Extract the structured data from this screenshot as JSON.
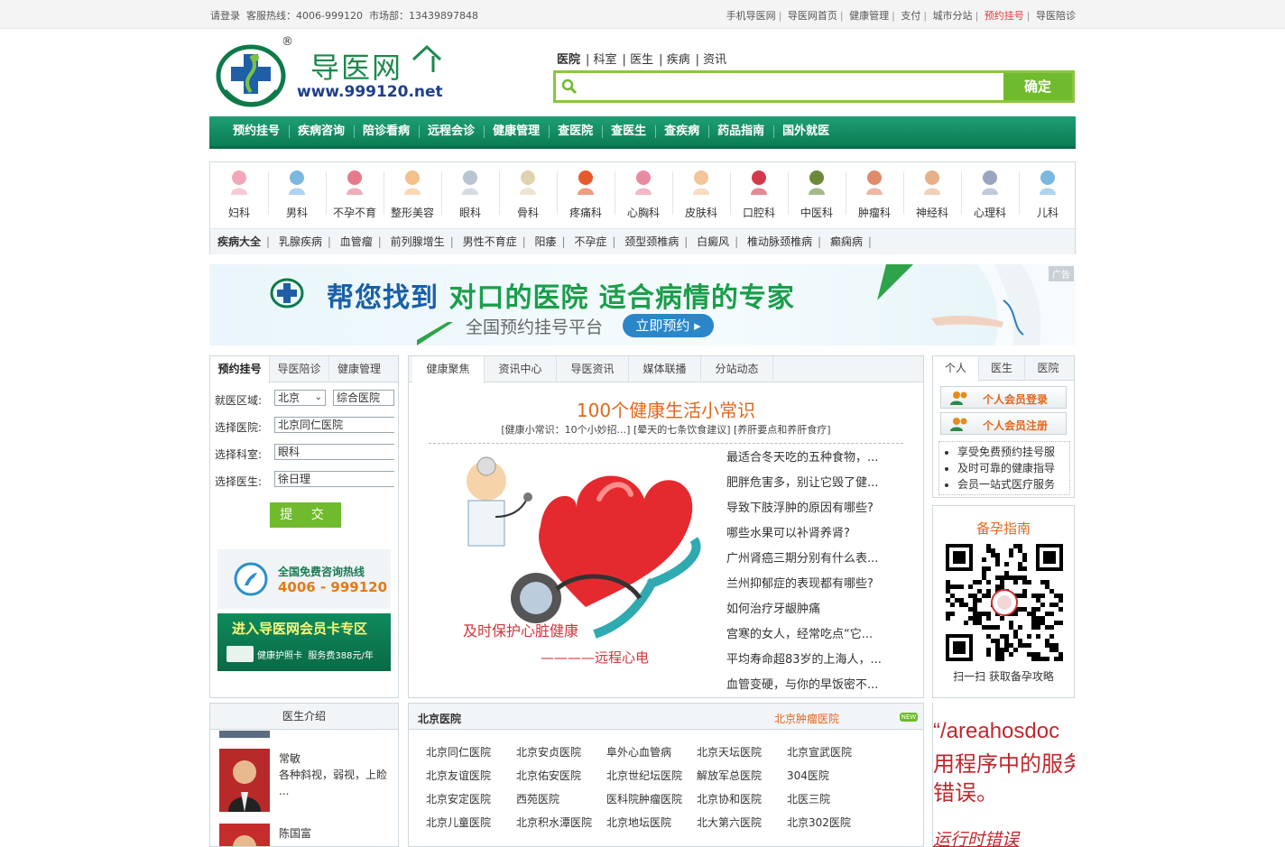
{
  "topbar": {
    "login": "请登录",
    "hotline": "客服热线：4006-999120",
    "market": "市场部：13439897848",
    "links": [
      "手机导医网",
      "导医网首页",
      "健康管理",
      "支付",
      "城市分站",
      "预约挂号",
      "导医陪诊"
    ]
  },
  "logo": {
    "name": "导医网",
    "url": "www.999120.net",
    "mark": "®"
  },
  "search": {
    "tabs": [
      "医院",
      "科室",
      "医生",
      "疾病",
      "资讯"
    ],
    "placeholder": "",
    "button": "确定"
  },
  "nav": [
    "预约挂号",
    "疾病咨询",
    "陪诊看病",
    "远程会诊",
    "健康管理",
    "查医院",
    "查医生",
    "查疾病",
    "药品指南",
    "国外就医"
  ],
  "departments": [
    "妇科",
    "男科",
    "不孕不育",
    "整形美容",
    "眼科",
    "骨科",
    "疼痛科",
    "心胸科",
    "皮肤科",
    "口腔科",
    "中医科",
    "肿瘤科",
    "神经科",
    "心理科",
    "儿科"
  ],
  "diseases": {
    "label": "疾病大全",
    "items": [
      "乳腺疾病",
      "血管瘤",
      "前列腺增生",
      "男性不育症",
      "阳痿",
      "不孕症",
      "颈型颈椎病",
      "白癜风",
      "椎动脉颈椎病",
      "癫痫病"
    ]
  },
  "banner": {
    "ad_tag": "广告",
    "headline_a": "帮您找到",
    "headline_b": "对口的医院 适合病情的专家",
    "sub": "全国预约挂号平台",
    "button": "立即预约 ▸"
  },
  "booking": {
    "tabs": [
      "预约挂号",
      "导医陪诊",
      "健康管理"
    ],
    "area_label": "就医区域:",
    "area_value": "北京",
    "area_type": "综合医院",
    "hospital_label": "选择医院:",
    "hospital_value": "北京同仁医院",
    "dept_label": "选择科室:",
    "dept_value": "眼科",
    "doctor_label": "选择医生:",
    "doctor_value": "徐日理",
    "submit": "提 交"
  },
  "hotline_box": {
    "title": "全国免费咨询热线",
    "number": "4006 - 999120"
  },
  "member_zone": {
    "title": "进入导医网会员卡专区",
    "card": "健康护照卡",
    "fee": "服务费388元/年"
  },
  "center": {
    "tabs": [
      "健康聚焦",
      "资讯中心",
      "导医资讯",
      "媒体联播",
      "分站动态"
    ],
    "title": "100个健康生活小常识",
    "subtitle": "[健康小常识：10个小妙招...] [晕天的七条饮食建议] [养肝要点和养肝食疗]",
    "image_caption1": "及时保护心脏健康",
    "image_caption2": "————远程心电",
    "news": [
      "最适合冬天吃的五种食物，...",
      "肥胖危害多，别让它毁了健...",
      "导致下肢浮肿的原因有哪些?",
      "哪些水果可以补肾养肾?",
      "广州肾癌三期分别有什么表...",
      "兰州抑郁症的表现都有哪些?",
      "如何治疗牙龈肿痛",
      "宫寒的女人，经常吃点“它...",
      "平均寿命超83岁的上海人，...",
      "血管变硬，与你的早饭密不..."
    ]
  },
  "member": {
    "tabs": [
      "个人",
      "医生",
      "医院"
    ],
    "login": "个人会员登录",
    "register": "个人会员注册",
    "benefits": [
      "享受免费预约挂号服",
      "及时可靠的健康指导",
      "会员一站式医疗服务"
    ]
  },
  "pregnancy": {
    "title": "备孕指南",
    "caption": "扫一扫 获取备孕攻略"
  },
  "doctors": {
    "title": "医生介绍",
    "list": [
      {
        "name": "常敏",
        "desc": "各种斜视，弱视，上睑 ..."
      },
      {
        "name": "陈国富",
        "desc": ""
      }
    ]
  },
  "hospitals": {
    "title": "北京医院",
    "link": "北京肿瘤医院",
    "badge": "NEW",
    "grid": [
      [
        "北京同仁医院",
        "北京安贞医院",
        "阜外心血管病",
        "北京天坛医院",
        "北京宣武医院"
      ],
      [
        "北京友谊医院",
        "北京佑安医院",
        "北京世纪坛医院",
        "解放军总医院",
        "304医院"
      ],
      [
        "北京安定医院",
        "西苑医院",
        "医科院肿瘤医院",
        "北京协和医院",
        "北医三院"
      ],
      [
        "北京儿童医院",
        "北京积水潭医院",
        "北京地坛医院",
        "北大第六医院",
        "北京302医院"
      ]
    ]
  },
  "error": {
    "line1": "“/areahosdoc",
    "line2": "用程序中的服务",
    "line3": "错误。",
    "line4": "运行时错误"
  },
  "colors": {
    "green": "#0c7c55",
    "accent_green": "#6fbb2d",
    "orange": "#e4661b",
    "red": "#c1272d"
  }
}
